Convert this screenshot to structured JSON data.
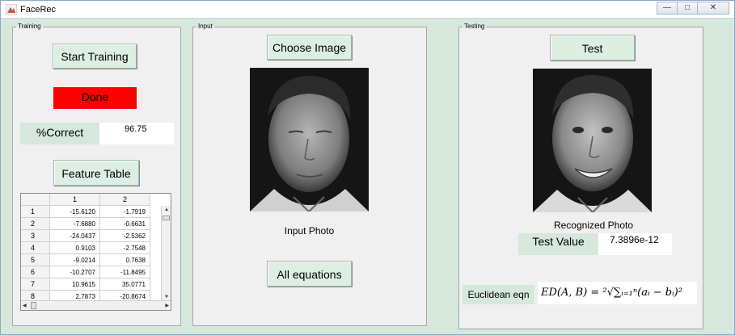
{
  "window": {
    "title": "FaceRec",
    "controls": [
      "—",
      "□",
      "✕"
    ]
  },
  "training": {
    "panel_title": "Training",
    "start_button": "Start Training",
    "status": "Done",
    "percent_label": "%Correct",
    "percent_value": "96.75",
    "feature_button": "Feature Table",
    "table": {
      "columns": [
        "1",
        "2"
      ],
      "rows": [
        {
          "index": "1",
          "c1": "-15.6120",
          "c2": "-1.7919"
        },
        {
          "index": "2",
          "c1": "-7.6880",
          "c2": "-0.6631"
        },
        {
          "index": "3",
          "c1": "-24.0437",
          "c2": "-2.5362"
        },
        {
          "index": "4",
          "c1": "0.9103",
          "c2": "-2.7548"
        },
        {
          "index": "5",
          "c1": "-9.0214",
          "c2": "0.7638"
        },
        {
          "index": "6",
          "c1": "-10.2707",
          "c2": "-11.8495"
        },
        {
          "index": "7",
          "c1": "10.9615",
          "c2": "35.0771"
        },
        {
          "index": "8",
          "c1": "2.7873",
          "c2": "-20.8674"
        }
      ]
    }
  },
  "input": {
    "panel_title": "Input",
    "choose_button": "Choose Image",
    "caption": "Input Photo",
    "equations_button": "All equations"
  },
  "testing": {
    "panel_title": "Testing",
    "test_button": "Test",
    "caption": "Recognized Photo",
    "test_value_label": "Test Value",
    "test_value": "7.3896e-12",
    "euclid_label": "Euclidean eqn",
    "formula": "ED(A, B) = ²√∑ᵢ₌₁ⁿ(aᵢ − bᵢ)²"
  },
  "colors": {
    "status_bg": "#ff0000",
    "window_bg": "#d6e8dc",
    "panel_bg": "#f0f0f0"
  }
}
